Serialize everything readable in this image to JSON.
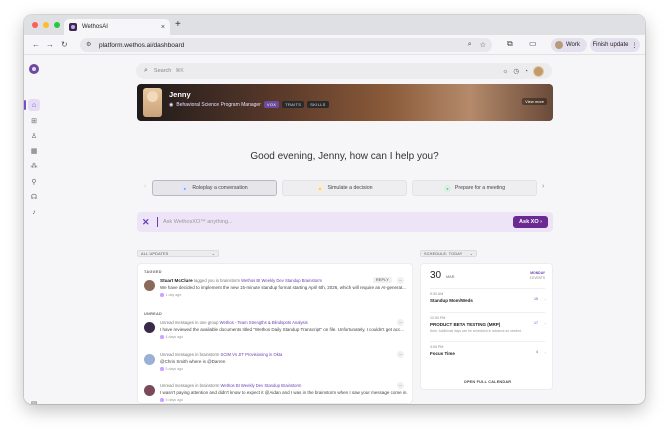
{
  "browser": {
    "tab_title": "WethosAI",
    "tab_close": "×",
    "new_tab": "+",
    "url": "platform.wethos.ai/dashboard",
    "profile_label": "Work",
    "finish_update_label": "Finish update"
  },
  "search": {
    "placeholder": "Search",
    "shortcut": "⌘K"
  },
  "profile_banner": {
    "name": "Jenny",
    "role": "Behavioral Science Program Manager",
    "chips": [
      "VOX",
      "TRAITS",
      "SKILLS"
    ],
    "view_label": "View more"
  },
  "greeting": "Good evening, Jenny, how can I help you?",
  "prompt_cards": [
    {
      "label": "Roleplay a conversation",
      "icon": "roleplay-icon",
      "color": "#7b8cde"
    },
    {
      "label": "Simulate a decision",
      "icon": "decision-icon",
      "color": "#e6b45a"
    },
    {
      "label": "Prepare for a meeting",
      "icon": "meeting-icon",
      "color": "#6bbf8a"
    }
  ],
  "ask": {
    "placeholder": "Ask WethosXO™ anything...",
    "button_label": "Ask XO"
  },
  "feed": {
    "filter_label": "ALL UPDATES",
    "sections": {
      "tagged": "TAGGED",
      "unread": "UNREAD"
    },
    "items": [
      {
        "author": "Stuart McClure",
        "action": "tagged you in brainstorm",
        "link": "Wethos BI Weekly Dev Standup Brainstorm",
        "text": "We have decided to implement the new 15-minute standup format starting April 6th, 2026, which will require an AI-generat...",
        "time": "1 day ago",
        "reply": "REPLY",
        "avatar_color": "#8a6a5a"
      },
      {
        "author": "",
        "action": "Unread messages in one group",
        "link": "Wethos - Team Strengths & Blindspots Analysis",
        "text": "I have reviewed the available documents titled \"Wethos Daily Standup Transcript\" on file. Unfortunately, I couldn't get acc...",
        "time": "4 days ago",
        "reply": "",
        "avatar_color": "#3a2a4a"
      },
      {
        "author": "",
        "action": "Unread messages in brainstorm",
        "link": "SCIM Vs JIT Provisioning in Okta",
        "text": "@Chris Smith where is @Darren",
        "time": "5 days ago",
        "reply": "",
        "avatar_color": "#9ab0d6"
      },
      {
        "author": "",
        "action": "Unread messages in brainstorm",
        "link": "Wethos BI Weekly Dev Standup Brainstorm",
        "text": "I wasn't paying attention and didn't know to expect it @Aidan and I was in the brainstorm when I saw your message come in.",
        "time": "5 days ago",
        "reply": "",
        "avatar_color": "#7a4a5a"
      }
    ]
  },
  "schedule": {
    "filter_label": "SCHEDULE: TODAY",
    "day": "30",
    "month": "MAR",
    "weekday": "MONDAY",
    "event_count": "3 EVENTS",
    "events": [
      {
        "time": "9:30 AM",
        "title": "Standup Mom/Weds",
        "sub": "",
        "count": "15"
      },
      {
        "time": "12:00 PM",
        "title": "PRODUCT BETA TESTING (MRP)",
        "sub": "Note: Additional days can be scheduled in advance as needed.",
        "count": "17"
      },
      {
        "time": "3:00 PM",
        "title": "Focus Time",
        "sub": "",
        "count": "4"
      }
    ],
    "open_label": "OPEN FULL CALENDAR"
  }
}
